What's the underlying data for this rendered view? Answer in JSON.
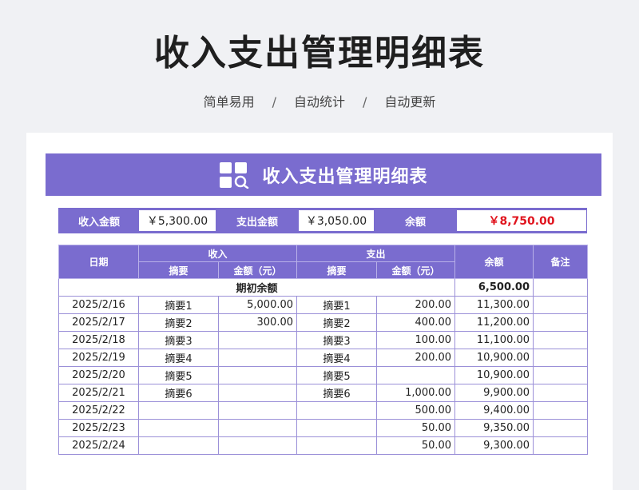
{
  "page": {
    "title": "收入支出管理明细表",
    "subtitle_items": [
      "简单易用",
      "自动统计",
      "自动更新"
    ],
    "separator": "/"
  },
  "sheet": {
    "title": "收入支出管理明细表",
    "summary": {
      "income_label": "收入金额",
      "income_value": "￥5,300.00",
      "expense_label": "支出金额",
      "expense_value": "￥3,050.00",
      "balance_label": "余额",
      "balance_value": "￥8,750.00"
    },
    "headers": {
      "date": "日期",
      "income": "收入",
      "expense": "支出",
      "summary": "摘要",
      "amount": "金额（元）",
      "balance": "余额",
      "note": "备注"
    },
    "opening": {
      "label": "期初余额",
      "balance": "6,500.00"
    },
    "rows": [
      {
        "date": "2025/2/16",
        "in_desc": "摘要1",
        "in_amt": "5,000.00",
        "out_desc": "摘要1",
        "out_amt": "200.00",
        "balance": "11,300.00",
        "note": ""
      },
      {
        "date": "2025/2/17",
        "in_desc": "摘要2",
        "in_amt": "300.00",
        "out_desc": "摘要2",
        "out_amt": "400.00",
        "balance": "11,200.00",
        "note": ""
      },
      {
        "date": "2025/2/18",
        "in_desc": "摘要3",
        "in_amt": "",
        "out_desc": "摘要3",
        "out_amt": "100.00",
        "balance": "11,100.00",
        "note": ""
      },
      {
        "date": "2025/2/19",
        "in_desc": "摘要4",
        "in_amt": "",
        "out_desc": "摘要4",
        "out_amt": "200.00",
        "balance": "10,900.00",
        "note": ""
      },
      {
        "date": "2025/2/20",
        "in_desc": "摘要5",
        "in_amt": "",
        "out_desc": "摘要5",
        "out_amt": "",
        "balance": "10,900.00",
        "note": ""
      },
      {
        "date": "2025/2/21",
        "in_desc": "摘要6",
        "in_amt": "",
        "out_desc": "摘要6",
        "out_amt": "1,000.00",
        "balance": "9,900.00",
        "note": ""
      },
      {
        "date": "2025/2/22",
        "in_desc": "",
        "in_amt": "",
        "out_desc": "",
        "out_amt": "500.00",
        "balance": "9,400.00",
        "note": ""
      },
      {
        "date": "2025/2/23",
        "in_desc": "",
        "in_amt": "",
        "out_desc": "",
        "out_amt": "50.00",
        "balance": "9,350.00",
        "note": ""
      },
      {
        "date": "2025/2/24",
        "in_desc": "",
        "in_amt": "",
        "out_desc": "",
        "out_amt": "50.00",
        "balance": "9,300.00",
        "note": ""
      }
    ]
  },
  "colors": {
    "accent": "#7a6ccf",
    "negative_highlight": "#e0141e",
    "background": "#f0f1f4"
  }
}
